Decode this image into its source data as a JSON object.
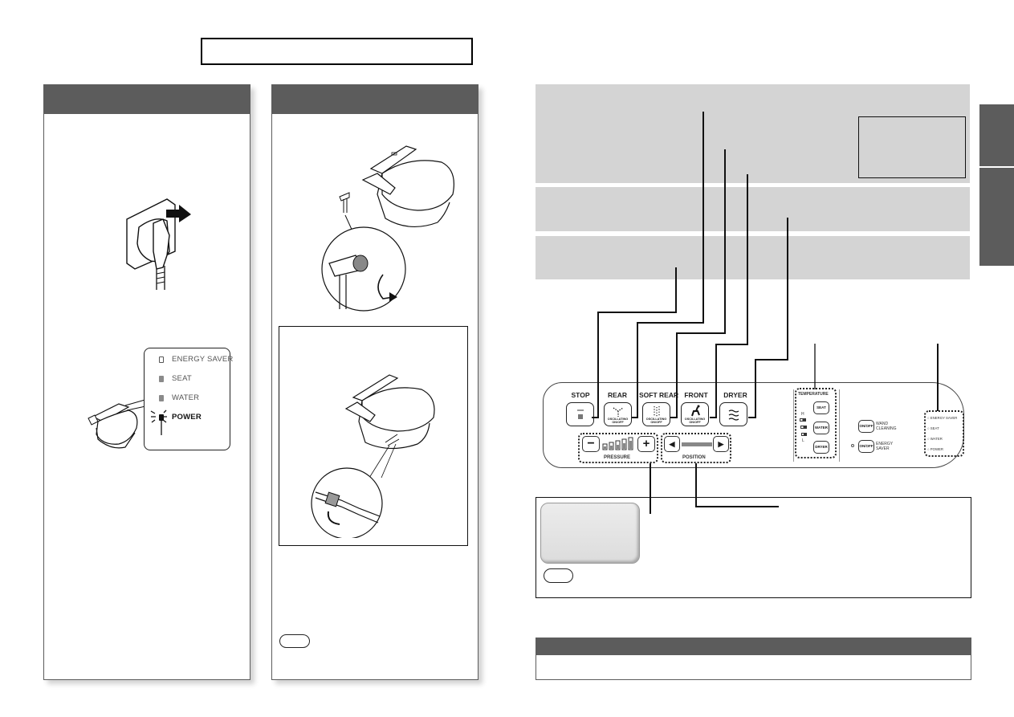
{
  "page": {
    "title_box_text": "",
    "left_panel": {
      "header": "",
      "plug_illustration": "power-plug-insertion",
      "indicator_card": {
        "items": [
          {
            "label": "ENERGY SAVER",
            "state": "off",
            "color": "#ffffff"
          },
          {
            "label": "SEAT",
            "state": "on",
            "color": "#8a8a8a"
          },
          {
            "label": "WATER",
            "state": "on",
            "color": "#8a8a8a"
          },
          {
            "label": "POWER",
            "state": "blinking",
            "color": "#111111"
          }
        ]
      }
    },
    "middle_panel": {
      "header": "",
      "valve_illustration": "supply-valve-open",
      "inset_illustration": "water-filter-connection",
      "note_label": ""
    },
    "right_page": {
      "bands": [
        "",
        "",
        ""
      ],
      "band_box_text": "",
      "side_tabs": [
        "",
        ""
      ],
      "control_panel": {
        "buttons": [
          {
            "label": "STOP",
            "icon": "stop-icon",
            "sub": ""
          },
          {
            "label": "REAR",
            "icon": "rear-spray-icon",
            "sub": "OSCILLATING ON/OFF"
          },
          {
            "label": "SOFT REAR",
            "icon": "soft-rear-spray-icon",
            "sub": "OSCILLATING ON/OFF"
          },
          {
            "label": "FRONT",
            "icon": "front-spray-icon",
            "sub": "OSCILLATING ON/OFF"
          },
          {
            "label": "DRYER",
            "icon": "dryer-icon",
            "sub": ""
          }
        ],
        "pressure": {
          "label": "PRESSURE",
          "minus": "−",
          "plus": "+",
          "level": 5,
          "max": 5
        },
        "position": {
          "label": "POSITION",
          "left": "◀",
          "right": "▶"
        },
        "temperature": {
          "label": "TEMPERATURE",
          "high": "H",
          "low": "L",
          "keys": [
            "SEAT",
            "WATER",
            "DRYER"
          ]
        },
        "wand_cleaning": {
          "key": "ON/OFF",
          "label_line1": "WAND",
          "label_line2": "CLEANING"
        },
        "energy_saver": {
          "key": "ON/OFF",
          "label_line1": "ENERGY",
          "label_line2": "SAVER"
        },
        "indicators": [
          "ENERGY SAVER",
          "SEAT",
          "WATER",
          "POWER"
        ]
      },
      "info_box": {
        "chip_text": "",
        "note_label": "",
        "text": ""
      },
      "bottom_box": {
        "header": "",
        "text": ""
      }
    }
  }
}
